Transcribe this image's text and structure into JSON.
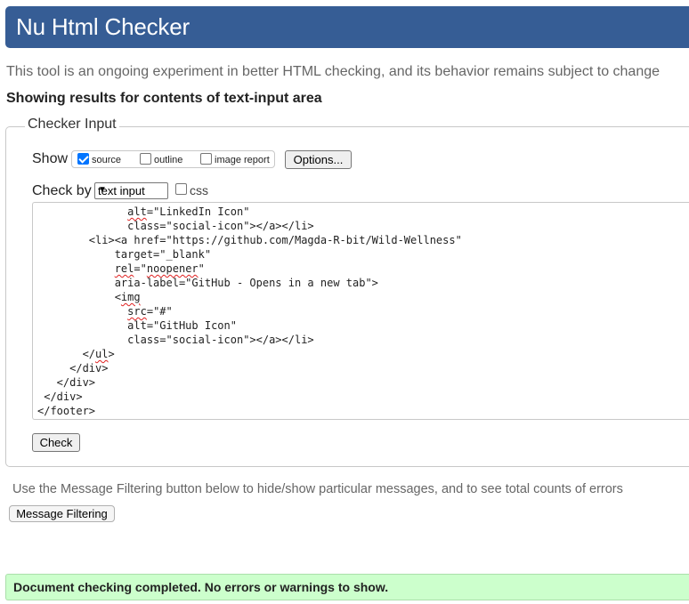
{
  "header": {
    "title": "Nu Html Checker"
  },
  "tagline": "This tool is an ongoing experiment in better HTML checking, and its behavior remains subject to change",
  "results_title": "Showing results for contents of text-input area",
  "checker_input": {
    "legend": "Checker Input",
    "show": {
      "label": "Show",
      "options": [
        {
          "label": "source",
          "checked": true
        },
        {
          "label": "outline",
          "checked": false
        },
        {
          "label": "image report",
          "checked": false
        }
      ],
      "options_button": "Options..."
    },
    "check_by": {
      "label": "Check by",
      "selected": "text input",
      "css_label": "css",
      "css_checked": false
    },
    "code_lines": [
      "              alt=\"LinkedIn Icon\"",
      "              class=\"social-icon\"></a></li>",
      "        <li><a href=\"https://github.com/Magda-R-bit/Wild-Wellness\"",
      "            target=\"_blank\"",
      "            rel=\"noopener\"",
      "            aria-label=\"GitHub - Opens in a new tab\">",
      "            <img",
      "              src=\"#\"",
      "              alt=\"GitHub Icon\"",
      "              class=\"social-icon\"></a></li>",
      "       </ul>",
      "     </div>",
      "   </div>",
      " </div>",
      "</footer>"
    ],
    "check_button": "Check"
  },
  "filter": {
    "text": "Use the Message Filtering button below to hide/show particular messages, and to see total counts of errors",
    "button": "Message Filtering"
  },
  "status": {
    "message": "Document checking completed. No errors or warnings to show.",
    "color": "#ccffcc"
  },
  "colors": {
    "header_bg": "#365d95",
    "accent_checkbox": "#0075ff"
  }
}
